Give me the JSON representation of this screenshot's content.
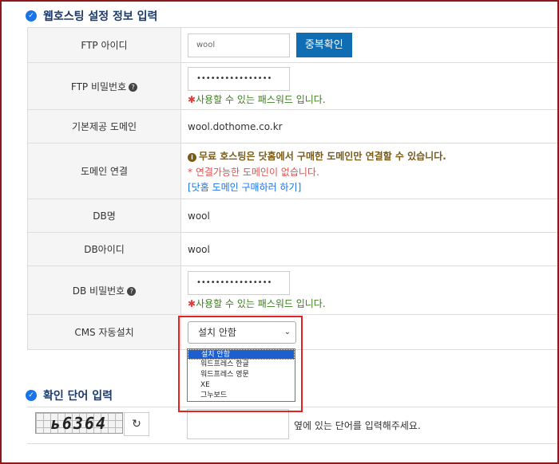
{
  "section1": {
    "title": "웹호스팅 설정 정보 입력"
  },
  "rows": {
    "ftp_id": {
      "label": "FTP 아이디",
      "value": "wool",
      "button": "중복확인"
    },
    "ftp_pw": {
      "label": "FTP 비밀번호",
      "value": "••••••••••••••••",
      "hint_star": "✱",
      "hint": "사용할 수 있는 패스워드 입니다."
    },
    "domain": {
      "label": "기본제공 도메인",
      "value": "wool.dothome.co.kr"
    },
    "domain_link": {
      "label": "도메인 연결",
      "notice": "무료 호스팅은 닷홈에서 구매한 도메인만 연결할 수 있습니다.",
      "warning": "* 연결가능한 도메인이 없습니다.",
      "link": "[닷홈 도메인 구매하러 하기]"
    },
    "db_name": {
      "label": "DB명",
      "value": "wool"
    },
    "db_id": {
      "label": "DB아이디",
      "value": "wool"
    },
    "db_pw": {
      "label": "DB 비밀번호",
      "value": "••••••••••••••••",
      "hint_star": "✱",
      "hint": "사용할 수 있는 패스워드 입니다."
    },
    "cms": {
      "label": "CMS 자동설치",
      "selected": "설치 안함"
    }
  },
  "cms_options": [
    "설치 안함",
    "워드프레스 한글",
    "워드프레스 영문",
    "XE",
    "그누보드"
  ],
  "section2": {
    "title": "확인 단어 입력"
  },
  "captcha": {
    "text": "ь6364",
    "hint": "옆에 있는 단어를 입력해주세요."
  },
  "icons": {
    "check": "check-circle-icon",
    "help": "question-circle-icon",
    "info": "info-circle-icon",
    "refresh": "refresh-icon",
    "chevron": "chevron-down-icon"
  },
  "colors": {
    "accent": "#0f6db3",
    "success": "#3c7d1f",
    "error": "#d9534f",
    "link": "#1a73e8",
    "highlight": "#e52222"
  }
}
